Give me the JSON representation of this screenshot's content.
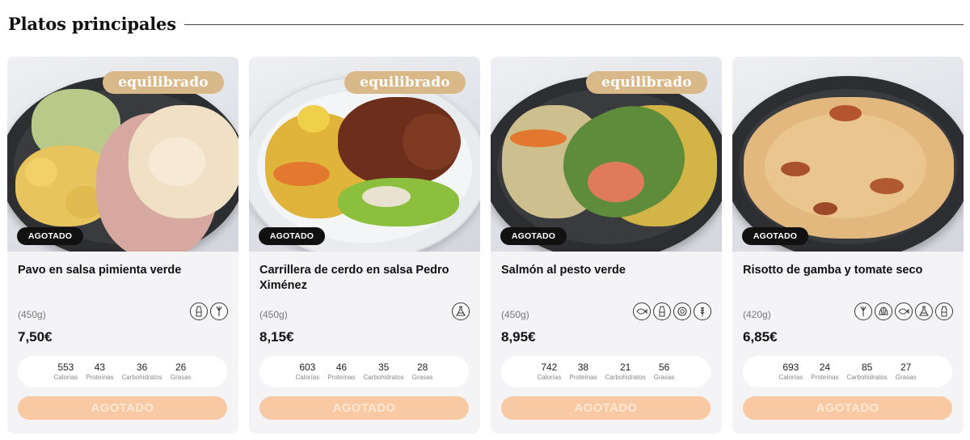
{
  "section": {
    "title": "Platos principales"
  },
  "colors": {
    "badge_equilibrado": "#d9b98a",
    "badge_agotado": "#111111",
    "button_agotado": "#f9c9a3",
    "card_bg": "#f4f4f7"
  },
  "cards": [
    {
      "badge": "equilibrado",
      "status": "AGOTADO",
      "name": "Pavo en salsa pimienta verde",
      "weight": "(450g)",
      "price": "7,50€",
      "icons": [
        "milk-bottle-icon",
        "celery-icon"
      ],
      "macros": [
        {
          "value": "553",
          "label": "Calorías"
        },
        {
          "value": "43",
          "label": "Proteínas"
        },
        {
          "value": "36",
          "label": "Carbohidratos"
        },
        {
          "value": "26",
          "label": "Grasas"
        }
      ],
      "button": "AGOTADO"
    },
    {
      "badge": "equilibrado",
      "status": "AGOTADO",
      "name": "Carrillera de cerdo en salsa Pedro Ximénez",
      "weight": "(450g)",
      "price": "8,15€",
      "icons": [
        "sulphites-flask-icon"
      ],
      "macros": [
        {
          "value": "603",
          "label": "Calorías"
        },
        {
          "value": "46",
          "label": "Proteínas"
        },
        {
          "value": "35",
          "label": "Carbohidratos"
        },
        {
          "value": "28",
          "label": "Grasas"
        }
      ],
      "button": "AGOTADO"
    },
    {
      "badge": "equilibrado",
      "status": "AGOTADO",
      "name": "Salmón al pesto verde",
      "weight": "(450g)",
      "price": "8,95€",
      "icons": [
        "fish-icon",
        "milk-bottle-icon",
        "nut-icon",
        "wheat-icon"
      ],
      "macros": [
        {
          "value": "742",
          "label": "Calorías"
        },
        {
          "value": "38",
          "label": "Proteínas"
        },
        {
          "value": "21",
          "label": "Carbohidratos"
        },
        {
          "value": "56",
          "label": "Grasas"
        }
      ],
      "button": "AGOTADO"
    },
    {
      "badge": "",
      "status": "AGOTADO",
      "name": "Risotto de gamba y tomate seco",
      "weight": "(420g)",
      "price": "6,85€",
      "icons": [
        "celery-icon",
        "shellfish-icon",
        "fish-icon",
        "sulphites-flask-icon",
        "milk-bottle-icon"
      ],
      "macros": [
        {
          "value": "693",
          "label": "Calorías"
        },
        {
          "value": "24",
          "label": "Proteínas"
        },
        {
          "value": "85",
          "label": "Carbohidratos"
        },
        {
          "value": "27",
          "label": "Grasas"
        }
      ],
      "button": "AGOTADO"
    }
  ]
}
